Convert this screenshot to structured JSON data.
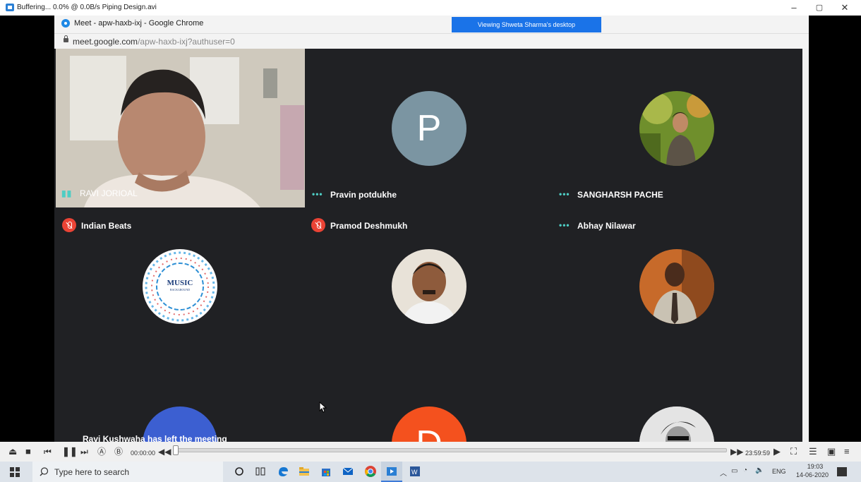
{
  "player": {
    "title": "Buffering...  0.0% @  0.0B/s Piping Design.avi",
    "window_controls": [
      "–",
      "▢",
      "✕"
    ],
    "current_time": "00:00:00",
    "total_time": "23:59:59",
    "progress_fraction": 0.0,
    "buttons": [
      "eject",
      "stop",
      "previous",
      "pause",
      "next",
      "A",
      "B",
      "rewind",
      "forward",
      "play",
      "fullscreen",
      "settings",
      "aspect",
      "playlist"
    ]
  },
  "browser": {
    "tab_title": "Meet - apw-haxb-ixj - Google Chrome",
    "url_host": "meet.google.com",
    "url_path": "/apw-haxb-ixj?authuser=0",
    "share_banner": "Viewing Shweta Sharma's desktop"
  },
  "meet": {
    "participants": [
      {
        "name": "RAVI JORIOAL",
        "status": "speaking",
        "avatar": "video-feed"
      },
      {
        "name": "Pravin potdukhe",
        "status": "unmuted",
        "avatar": "letter",
        "letter": "P",
        "color": "#7b95a2"
      },
      {
        "name": "SANGHARSH PACHE",
        "status": "unmuted",
        "avatar": "photo"
      },
      {
        "name": "Indian Beats",
        "status": "muted",
        "avatar": "music-logo",
        "logo_text": "MUSIC",
        "logo_sub": "BACKGROUND"
      },
      {
        "name": "Pramod Deshmukh",
        "status": "muted",
        "avatar": "photo"
      },
      {
        "name": "Abhay Nilawar",
        "status": "unmuted",
        "avatar": "photo"
      },
      {
        "name": "",
        "status": "",
        "avatar": "partial",
        "color": "#3c5fd1"
      },
      {
        "name": "",
        "status": "",
        "avatar": "partial-letter",
        "letter": "D",
        "color": "#f4511e"
      },
      {
        "name": "",
        "status": "",
        "avatar": "partial-photo"
      }
    ],
    "notification": "Ravi Kushwaha has left the meeting"
  },
  "taskbar": {
    "search_placeholder": "Type here to search",
    "tray_lang": "ENG",
    "clock_time": "19:03",
    "clock_date": "14-06-2020"
  }
}
